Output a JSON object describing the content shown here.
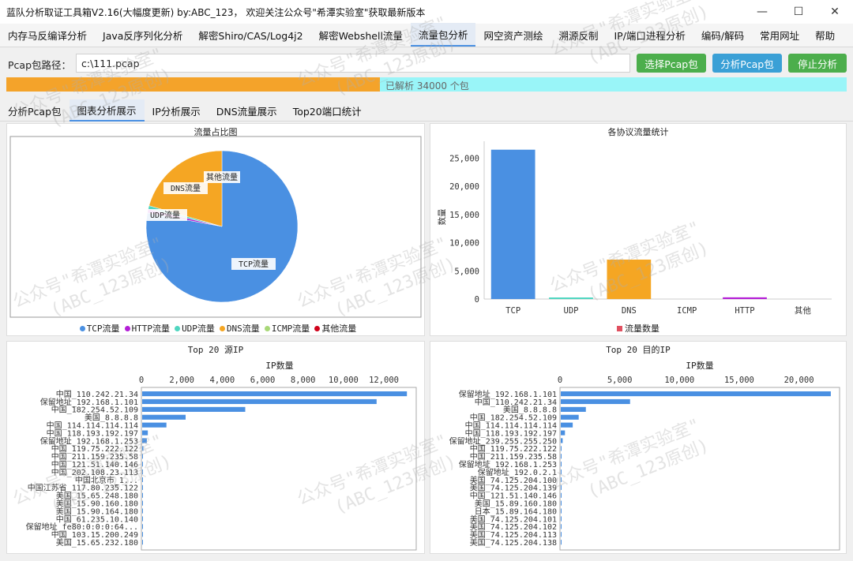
{
  "window": {
    "title": "蓝队分析取证工具箱V2.16(大幅度更新) by:ABC_123， 欢迎关注公众号\"希潭实验室\"获取最新版本",
    "min_glyph": "—",
    "max_glyph": "☐",
    "close_glyph": "✕"
  },
  "menu": [
    {
      "label": "内存马反编译分析"
    },
    {
      "label": "Java反序列化分析"
    },
    {
      "label": "解密Shiro/CAS/Log4j2"
    },
    {
      "label": "解密Webshell流量"
    },
    {
      "label": "流量包分析"
    },
    {
      "label": "网空资产测绘"
    },
    {
      "label": "溯源反制"
    },
    {
      "label": "IP/端口进程分析"
    },
    {
      "label": "编码/解码"
    },
    {
      "label": "常用网址"
    },
    {
      "label": "帮助"
    }
  ],
  "pcap": {
    "label": "Pcap包路径：",
    "path": "c:\\111.pcap",
    "select_button": "选择Pcap包",
    "analyze_button": "分析Pcap包",
    "stop_button": "停止分析"
  },
  "progress": {
    "text": "已解析 34000 个包",
    "fraction": 0.445
  },
  "tabs": [
    {
      "label": "分析Pcap包"
    },
    {
      "label": "图表分析展示"
    },
    {
      "label": "IP分析展示"
    },
    {
      "label": "DNS流量展示"
    },
    {
      "label": "Top20端口统计"
    }
  ],
  "colors": {
    "blue": "#4a90e2",
    "purple": "#b31ed6",
    "teal": "#50d6c0",
    "orange": "#f5a623",
    "lightgreen": "#a8d878",
    "red": "#d0021b"
  },
  "chart_data": [
    {
      "type": "pie",
      "title": "流量占比图",
      "slices": [
        {
          "name": "TCP流量",
          "value": 26500,
          "color": "#4a90e2"
        },
        {
          "name": "HTTP流量",
          "value": 280,
          "color": "#b31ed6"
        },
        {
          "name": "UDP流量",
          "value": 250,
          "color": "#50d6c0"
        },
        {
          "name": "DNS流量",
          "value": 7000,
          "color": "#f5a623"
        },
        {
          "name": "ICMP流量",
          "value": 0,
          "color": "#a8d878"
        },
        {
          "name": "其他流量",
          "value": 0,
          "color": "#d0021b"
        }
      ],
      "slice_labels": [
        "TCP流量",
        "UDP流量",
        "DNS流量",
        "其他流量"
      ],
      "legend": [
        "TCP流量",
        "HTTP流量",
        "UDP流量",
        "DNS流量",
        "ICMP流量",
        "其他流量"
      ]
    },
    {
      "type": "bar",
      "title": "各协议流量统计",
      "categories": [
        "TCP",
        "UDP",
        "DNS",
        "ICMP",
        "HTTP",
        "其他"
      ],
      "values": [
        26500,
        150,
        7000,
        0,
        300,
        0
      ],
      "colors": [
        "#4a90e2",
        "#50d6c0",
        "#f5a623",
        "#a8d878",
        "#b31ed6",
        "#d0021b"
      ],
      "ylabel": "数量",
      "yticks": [
        "0",
        "5,000",
        "10,000",
        "15,000",
        "20,000",
        "25,000"
      ],
      "ylim": [
        0,
        28000
      ],
      "legend": "流量数量"
    },
    {
      "type": "bar",
      "orientation": "horizontal",
      "title": "Top 20 源IP",
      "xlabel": "IP数量",
      "xticks": [
        "0",
        "2,000",
        "4,000",
        "6,000",
        "8,000",
        "10,000",
        "12,000"
      ],
      "xlim": [
        0,
        13600
      ],
      "categories": [
        "中国_110.242.21.34",
        "保留地址_192.168.1.101",
        "中国_182.254.52.109",
        "美国_8.8.8.8",
        "中国_114.114.114.114",
        "中国_118.193.192.197",
        "保留地址_192.168.1.253",
        "中国_119.75.222.122",
        "中国_211.159.235.58",
        "中国_121.51.140.146",
        "中国_202.108.23.113",
        "中国北京市_1...",
        "中国江苏省_117.80.235.122",
        "美国_15.65.248.180",
        "美国_15.90.160.180",
        "美国_15.90.164.180",
        "中国_61.235.10.140",
        "保留地址_fe80:0:0:0:64...",
        "中国_103.15.200.249",
        "美国_15.65.232.180"
      ],
      "values": [
        13100,
        11600,
        5100,
        2150,
        1200,
        280,
        230,
        60,
        30,
        20,
        15,
        10,
        8,
        5,
        5,
        5,
        4,
        3,
        3,
        3
      ]
    },
    {
      "type": "bar",
      "orientation": "horizontal",
      "title": "Top 20 目的IP",
      "xlabel": "IP数量",
      "xticks": [
        "0",
        "5,000",
        "10,000",
        "15,000",
        "20,000"
      ],
      "xlim": [
        0,
        23400
      ],
      "categories": [
        "保留地址_192.168.1.101",
        "中国_110.242.21.34",
        "美国_8.8.8.8",
        "中国_182.254.52.109",
        "中国_114.114.114.114",
        "中国_118.193.192.197",
        "保留地址_239.255.255.250",
        "中国_119.75.222.122",
        "中国_211.159.235.58",
        "保留地址_192.168.1.253",
        "保留地址_192.0.2.1",
        "美国_74.125.204.100",
        "美国_74.125.204.139",
        "中国_121.51.140.146",
        "美国_15.89.160.180",
        "日本_15.89.164.180",
        "美国_74.125.204.101",
        "美国_74.125.204.102",
        "美国_74.125.204.113",
        "美国_74.125.204.138"
      ],
      "values": [
        22600,
        5800,
        2100,
        1500,
        1000,
        350,
        160,
        60,
        30,
        20,
        15,
        10,
        8,
        5,
        5,
        5,
        4,
        3,
        3,
        3
      ]
    }
  ],
  "watermark": [
    "公众号\"希潭实验室\"",
    "(ABC_123原创)"
  ]
}
